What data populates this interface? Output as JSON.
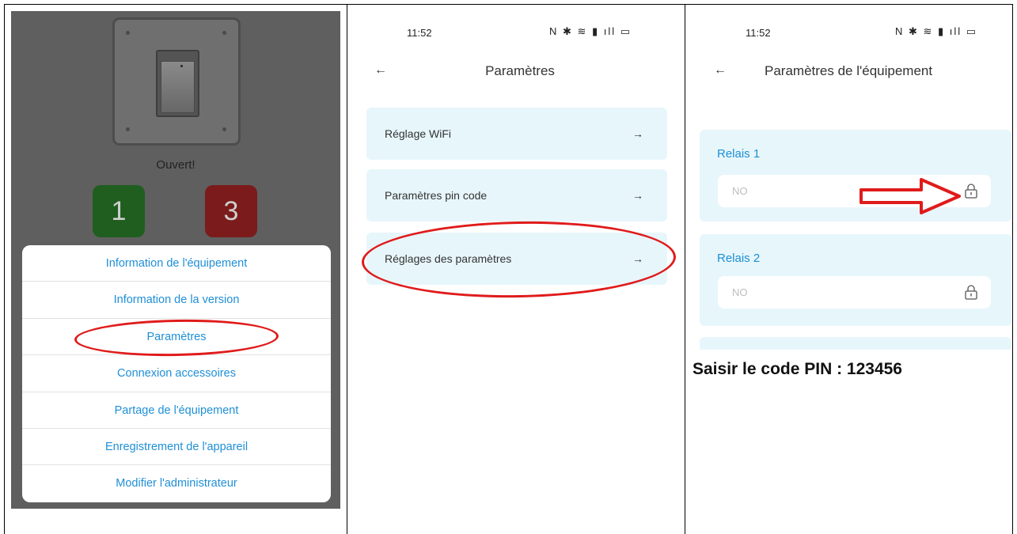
{
  "panel1": {
    "status_text": "Ouvert!",
    "relay_buttons": [
      "1",
      "3"
    ],
    "menu_items": [
      "Information de l'équipement",
      "Information de la version",
      "Paramètres",
      "Connexion accessoires",
      "Partage de l'équipement",
      "Enregistrement de l'appareil",
      "Modifier l'administrateur"
    ],
    "highlighted_item": "Paramètres"
  },
  "panel2": {
    "time": "11:52",
    "status_icons": "N ✱ ≋ ▮ ıll ▭",
    "back_icon": "←",
    "title": "Paramètres",
    "items": [
      {
        "label": "Réglage WiFi",
        "arrow": "→"
      },
      {
        "label": "Paramètres pin code",
        "arrow": "→"
      },
      {
        "label": "Réglages des paramètres",
        "arrow": "→"
      }
    ],
    "highlighted_item": "Réglages des paramètres"
  },
  "panel3": {
    "time": "11:52",
    "status_icons": "N ✱ ≋ ▮ ıll ▭",
    "back_icon": "←",
    "title": "Paramètres de l'équipement",
    "relays": [
      {
        "title": "Relais 1",
        "value": "NO"
      },
      {
        "title": "Relais 2",
        "value": "NO"
      }
    ],
    "pin_note": "Saisir le code PIN : 123456"
  },
  "colors": {
    "accent_blue": "#1f8fd6",
    "card_bg": "#e7f6fb",
    "annotation_red": "#e01b1b"
  }
}
